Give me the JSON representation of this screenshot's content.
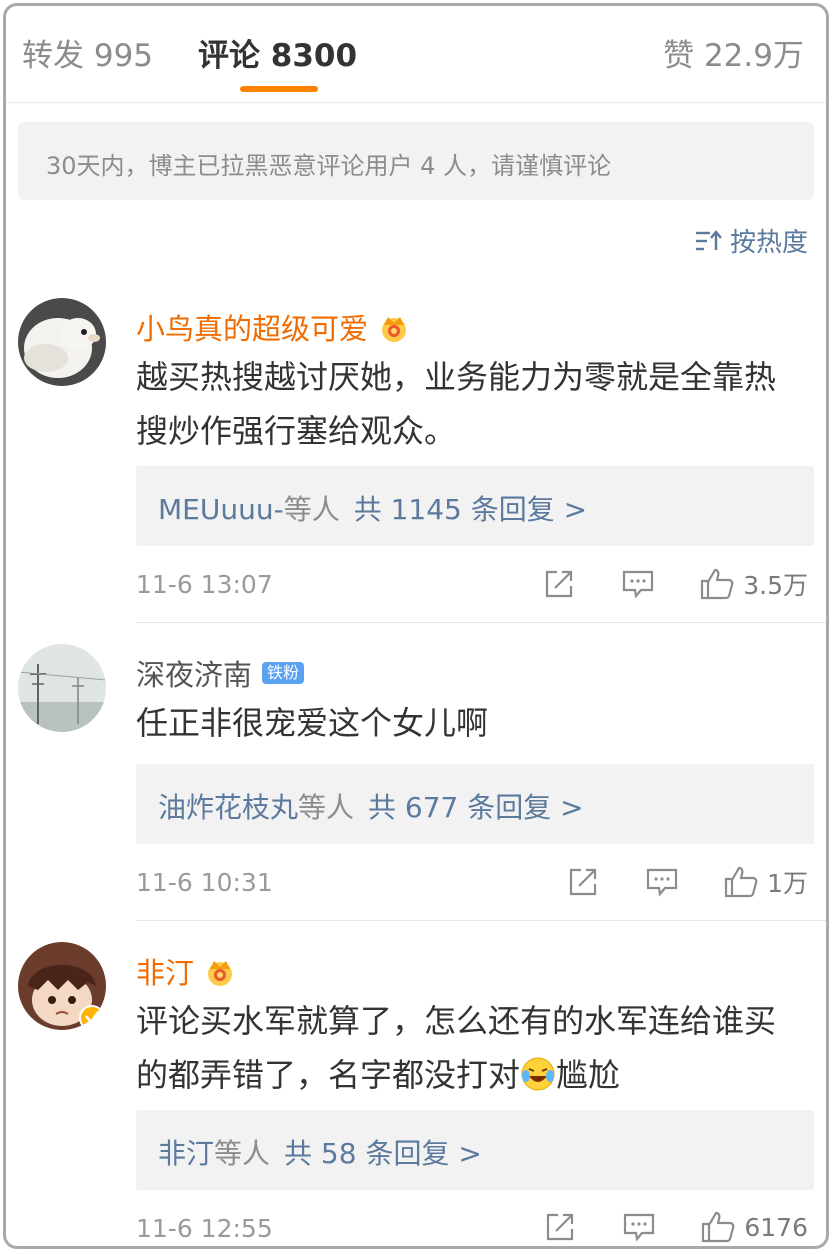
{
  "tabs": {
    "repost": "转发 995",
    "comment": "评论 8300",
    "likes": "赞 22.9万"
  },
  "notice": "30天内，博主已拉黑恶意评论用户 4 人，请谨慎评论",
  "sort_label": "按热度",
  "colors": {
    "accent": "#ff8200",
    "vip_name": "#f06b00",
    "link": "#5b7a9e",
    "fan_badge": "#5aa1f2"
  },
  "comments": [
    {
      "username": "小鸟真的超级可爱",
      "badge_icon": "crown-vip-icon",
      "text": "越买热搜越讨厌她，业务能力为零就是全靠热搜炒作强行塞给观众。",
      "reply_names": "MEUuuu-",
      "reply_suffix": "等人",
      "reply_total": "共 1145 条回复 >",
      "time": "11-6 13:07",
      "likes": "3.5万"
    },
    {
      "username": "深夜济南",
      "fan_badge": "铁粉",
      "text": "任正非很宠爱这个女儿啊",
      "reply_names": "油炸花枝丸",
      "reply_suffix": "等人",
      "reply_total": "共 677 条回复 >",
      "time": "11-6 10:31",
      "likes": "1万"
    },
    {
      "username": "非汀",
      "badge_icon": "crown-vip-icon",
      "text_part1": "评论买水军就算了，怎么还有的水军连给谁买的都弄错了，名字都没打对",
      "text_part2": "尴尬",
      "emoji": "laughing-crying-emoji",
      "reply_names": "非汀",
      "reply_suffix": "等人",
      "reply_total": "共 58 条回复 >",
      "time": "11-6 12:55",
      "likes": "6176"
    }
  ]
}
